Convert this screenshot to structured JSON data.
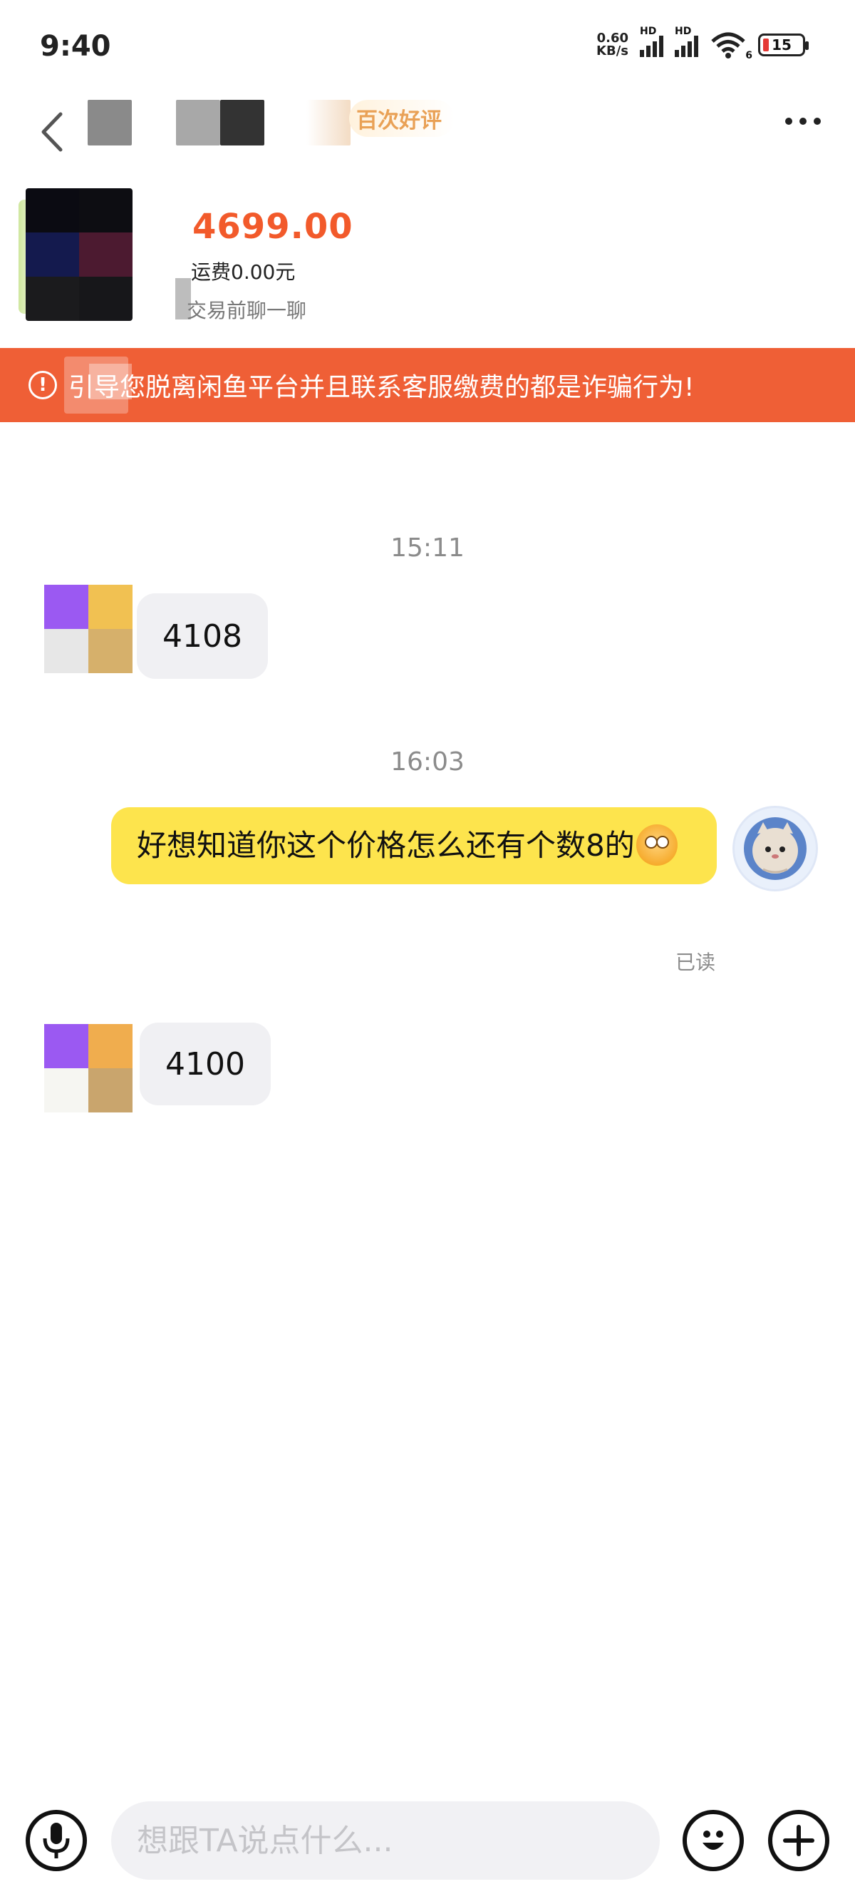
{
  "status_bar": {
    "time": "9:40",
    "net_speed_value": "0.60",
    "net_speed_unit": "KB/s",
    "signal_label": "HD",
    "wifi_badge": "6",
    "battery_level": "15"
  },
  "header": {
    "badge_text": "百次好评"
  },
  "product": {
    "price": "4699.00",
    "shipping": "运费0.00元",
    "chat_hint": "交易前聊一聊"
  },
  "warning": {
    "text": "引导您脱离闲鱼平台并且联系客服缴费的都是诈骗行为!"
  },
  "messages": [
    {
      "type": "timestamp",
      "text": "15:11"
    },
    {
      "type": "received",
      "text": "4108"
    },
    {
      "type": "timestamp",
      "text": "16:03"
    },
    {
      "type": "sent",
      "text": "好想知道你这个价格怎么还有个数8的",
      "status": "已读"
    },
    {
      "type": "received",
      "text": "4100"
    }
  ],
  "input": {
    "placeholder": "想跟TA说点什么..."
  },
  "colors": {
    "accent_orange": "#ef5f36",
    "price": "#f25a2b",
    "sent_bubble": "#fde44d",
    "received_bubble": "#f0f0f3"
  }
}
